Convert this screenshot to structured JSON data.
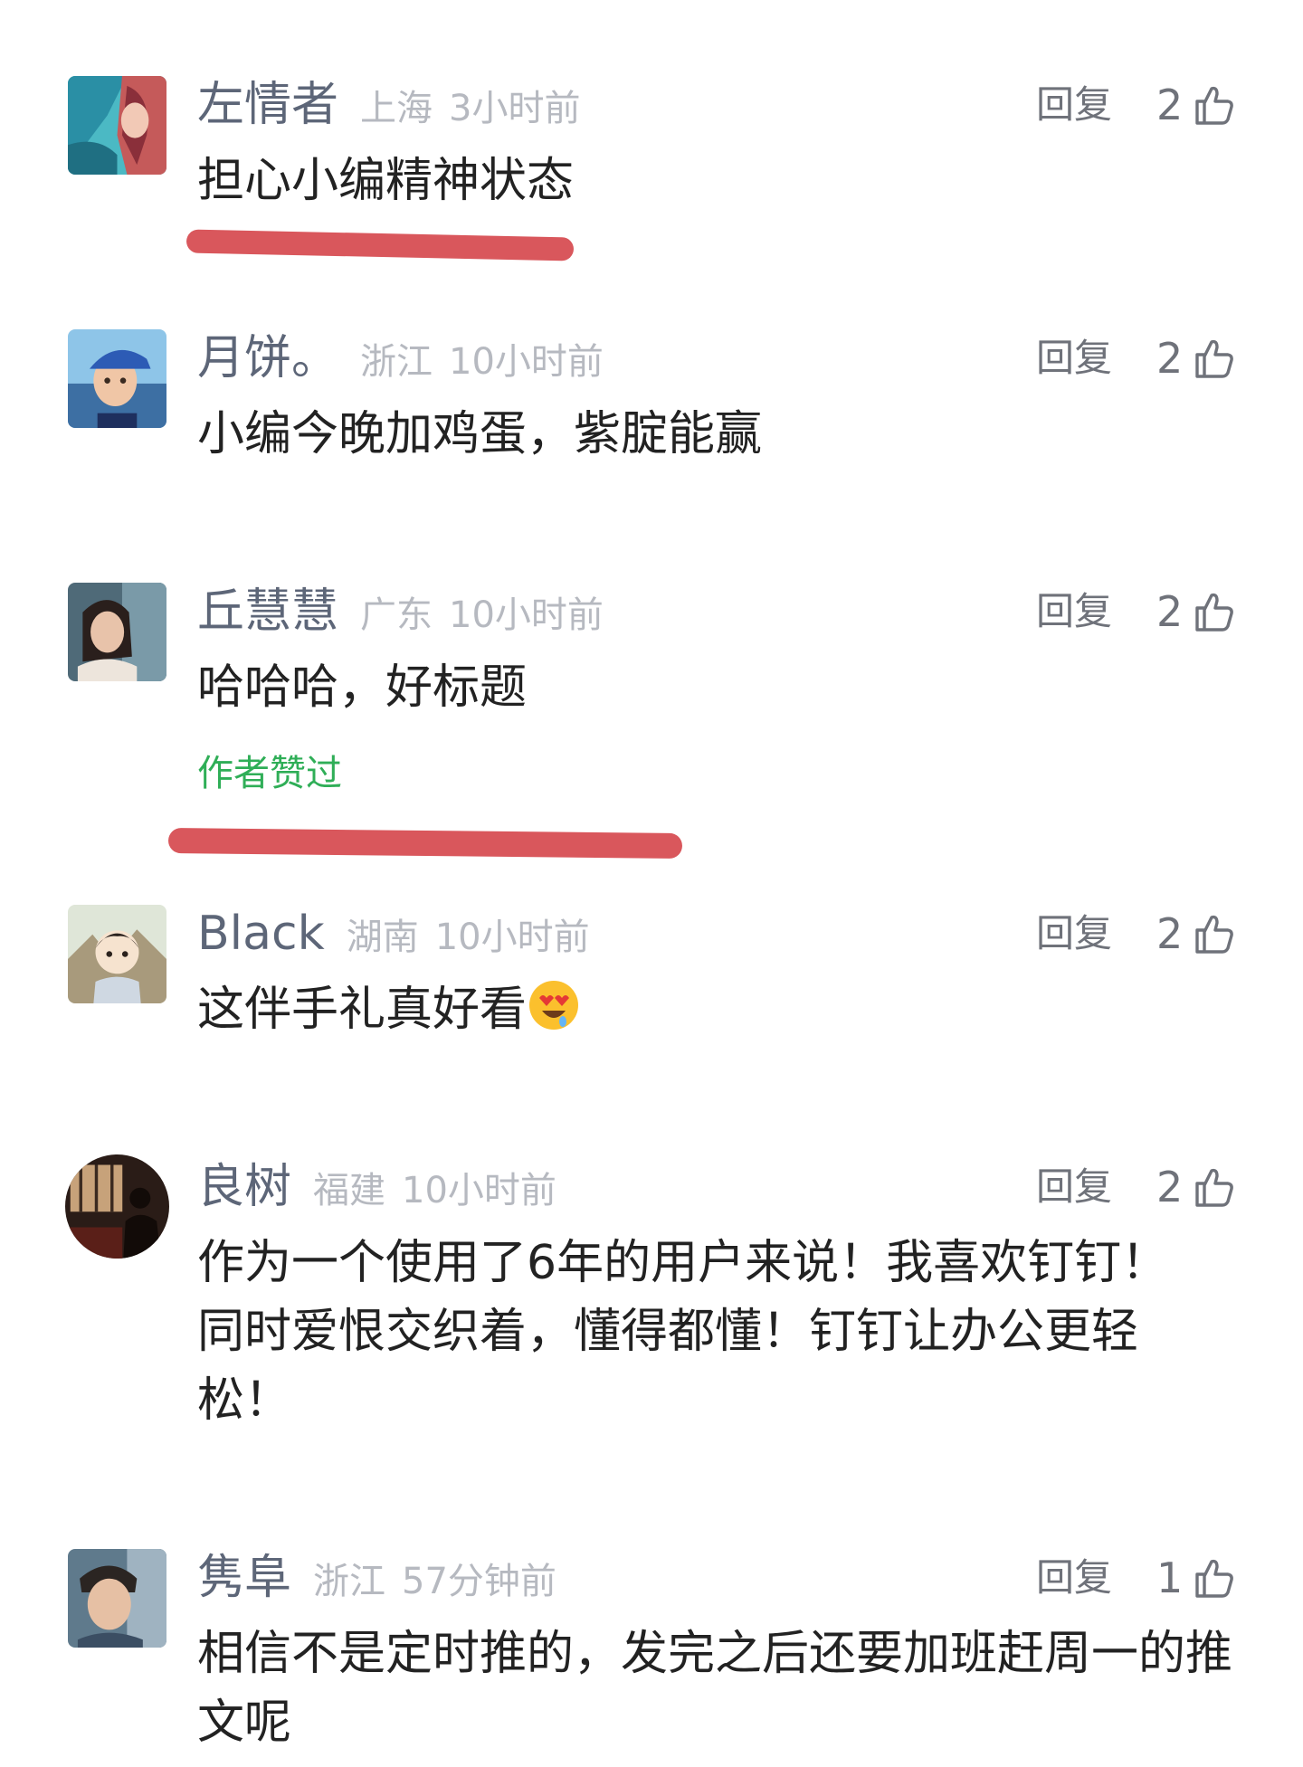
{
  "comments": [
    {
      "name": "左情者",
      "location": "上海",
      "time": "3小时前",
      "reply_label": "回复",
      "likes": "2",
      "text": "担心小编精神状态",
      "avatar": "anime-girl-avatar"
    },
    {
      "name": "月饼。",
      "location": "浙江",
      "time": "10小时前",
      "reply_label": "回复",
      "likes": "2",
      "text": "小编今晚加鸡蛋，紫腚能赢",
      "avatar": "cartoon-boy-cap-avatar"
    },
    {
      "name": "丘慧慧",
      "location": "广东",
      "time": "10小时前",
      "reply_label": "回复",
      "likes": "2",
      "text": "哈哈哈，好标题",
      "badge": "作者赞过",
      "avatar": "woman-in-car-avatar"
    },
    {
      "name": "Black",
      "location": "湖南",
      "time": "10小时前",
      "reply_label": "回复",
      "likes": "2",
      "text": "这伴手礼真好看",
      "emoji": "heart-eyes-emoji",
      "avatar": "cartoon-kid-avatar"
    },
    {
      "name": "良树",
      "location": "福建",
      "time": "10小时前",
      "reply_label": "回复",
      "likes": "2",
      "text": "作为一个使用了6年的用户来说！我喜欢钉钉！同时爱恨交织着，懂得都懂！钉钉让办公更轻松！",
      "avatar": "silhouette-avatar"
    },
    {
      "name": "隽阜",
      "location": "浙江",
      "time": "57分钟前",
      "reply_label": "回复",
      "likes": "1",
      "text": "相信不是定时推的，发完之后还要加班赶周一的推文呢",
      "avatar": "child-photo-avatar"
    }
  ],
  "colors": {
    "name": "#5d6678",
    "meta": "#b6b9c0",
    "text": "#222222",
    "badge": "#2fae57",
    "highlight": "#d9575c"
  }
}
